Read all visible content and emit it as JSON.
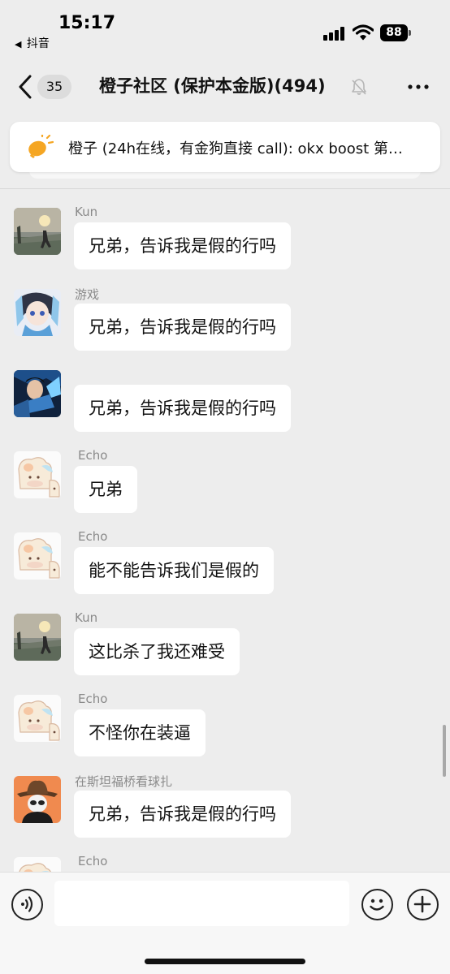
{
  "status_bar": {
    "time": "15:17",
    "back_app_label": "抖音",
    "back_arrow": "◀",
    "battery_level": "88",
    "signal_icon": "cellular-signal-icon",
    "wifi_icon": "wifi-icon"
  },
  "nav": {
    "unread_count": "35",
    "title": "橙子社区 (保护本金版)(494)",
    "more_icon": "more-dots-icon",
    "mute_icon": "mute-bell-icon"
  },
  "pinned": {
    "text": "橙子 (24h在线，有金狗直接 call): okx boost 第…",
    "icon": "lightbulb-icon",
    "accent_color": "#f5a623"
  },
  "messages": [
    {
      "sender": "Kun",
      "text": "兄弟，告诉我是假的行吗"
    },
    {
      "sender": "游戏",
      "text": "兄弟，告诉我是假的行吗"
    },
    {
      "sender": "",
      "text": "兄弟，告诉我是假的行吗"
    },
    {
      "sender": "Echo",
      "text": "兄弟"
    },
    {
      "sender": "Echo",
      "text": "能不能告诉我们是假的"
    },
    {
      "sender": "Kun",
      "text": "这比杀了我还难受"
    },
    {
      "sender": "Echo",
      "text": "不怪你在装逼"
    },
    {
      "sender": "在斯坦福桥看球扎",
      "text": "兄弟，告诉我是假的行吗"
    },
    {
      "sender": "Echo",
      "text": ""
    }
  ],
  "input_bar": {
    "voice_icon": "voice-input-icon",
    "emoji_icon": "emoji-icon",
    "plus_icon": "plus-icon",
    "text_value": ""
  }
}
